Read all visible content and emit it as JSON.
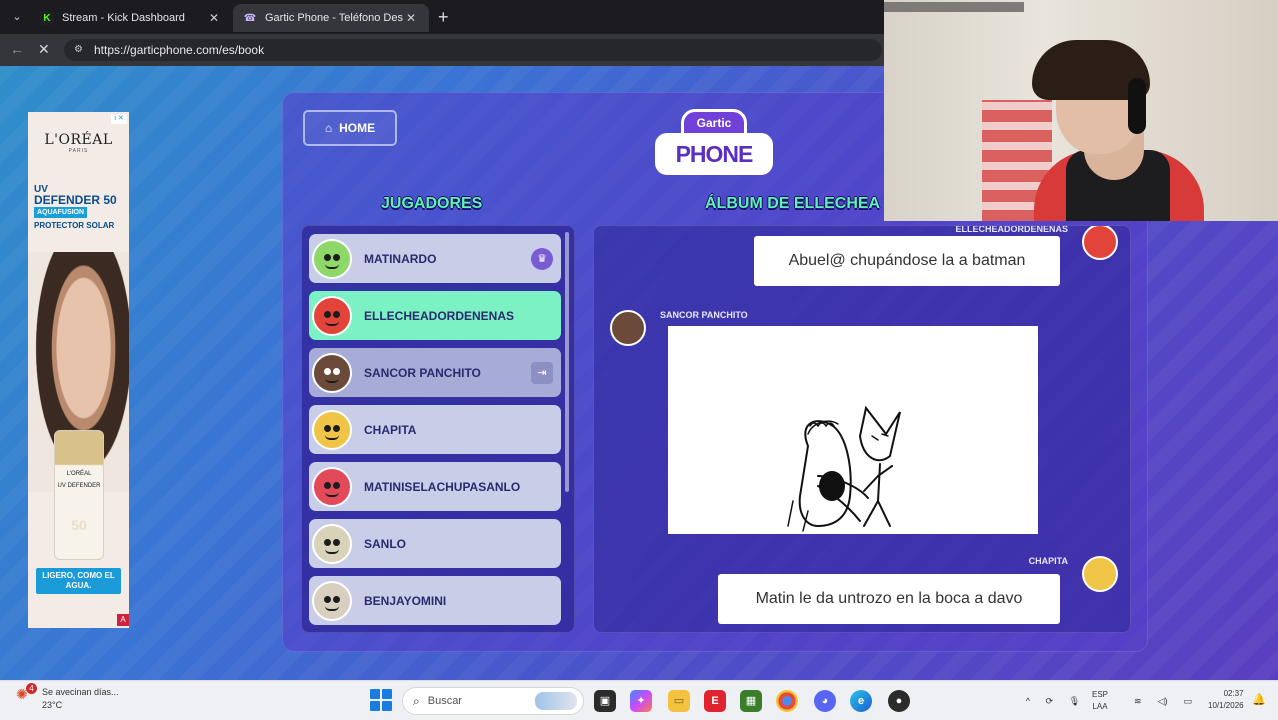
{
  "browser": {
    "tabs": [
      {
        "label": "Stream - Kick Dashboard",
        "icon": "kick-icon"
      },
      {
        "label": "Gartic Phone - Teléfono Descomp",
        "icon": "gartic-icon"
      }
    ],
    "url": "https://garticphone.com/es/book"
  },
  "ad": {
    "brand": "L'ORÉAL",
    "brand_sub": "PARIS",
    "line1": "UV",
    "line2": "DEFENDER 50",
    "line3": "AQUAFUSION",
    "line4": "PROTECTOR SOLAR",
    "bottle_brand": "L'ORÉAL",
    "bottle_line": "UV DEFENDER",
    "bottle_num": "50",
    "slogan": "LIGERO, COMO EL AGUA."
  },
  "game": {
    "home_label": "HOME",
    "logo_top": "Gartic",
    "logo_main": "PHONE",
    "players_heading": "JUGADORES",
    "album_heading": "ÁLBUM DE ELLECHEA",
    "players": [
      {
        "name": "MATINARDO",
        "color": "#8ed86a",
        "badge": "crown"
      },
      {
        "name": "ELLECHEADORDENENAS",
        "color": "#e2443a",
        "badge": ""
      },
      {
        "name": "SANCOR PANCHITO",
        "color": "#6b4a3a",
        "badge": "exit"
      },
      {
        "name": "CHAPITA",
        "color": "#f0c447",
        "badge": ""
      },
      {
        "name": "MATINISELACHUPASANLO",
        "color": "#e24a5a",
        "badge": ""
      },
      {
        "name": "SANLO",
        "color": "#d8d2b8",
        "badge": ""
      },
      {
        "name": "BENJAYOMINI",
        "color": "#d8cfc0",
        "badge": ""
      }
    ],
    "album": [
      {
        "author": "ELLECHEADORDENENAS",
        "type": "text",
        "text": "Abuel@ chupándose la a batman"
      },
      {
        "author": "SANCOR PANCHITO",
        "type": "drawing"
      },
      {
        "author": "CHAPITA",
        "type": "text",
        "text": "Matin le da untrozo en la boca a davo"
      }
    ]
  },
  "taskbar": {
    "weather_text": "Se avecinan días...",
    "weather_temp": "23°C",
    "weather_badge": "4",
    "search_placeholder": "Buscar",
    "lang1": "ESP",
    "lang2": "LAA",
    "time": "02:37",
    "date": "10/1/2026"
  }
}
